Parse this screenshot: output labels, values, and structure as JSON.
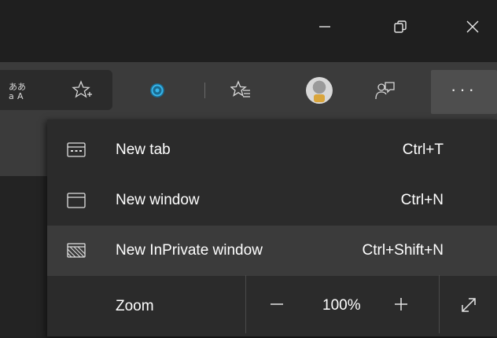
{
  "titlebar": {
    "buttons": [
      {
        "name": "minimize-icon"
      },
      {
        "name": "restore-icon"
      },
      {
        "name": "close-icon"
      }
    ]
  },
  "toolbar": {
    "icons": [
      "translate-icon",
      "add-favorite-icon",
      "extension-icon",
      "favorites-icon",
      "avatar",
      "feedback-icon",
      "more-icon"
    ],
    "more_label": "···",
    "accent_color": "#2aa0d6"
  },
  "menu": {
    "items": [
      {
        "icon": "new-tab-icon",
        "label": "New tab",
        "shortcut": "Ctrl+T"
      },
      {
        "icon": "new-window-icon",
        "label": "New window",
        "shortcut": "Ctrl+N"
      },
      {
        "icon": "inprivate-icon",
        "label": "New InPrivate window",
        "shortcut": "Ctrl+Shift+N",
        "highlighted": true
      }
    ],
    "zoom": {
      "label": "Zoom",
      "minus": "—",
      "value": "100%",
      "plus": "+"
    }
  }
}
